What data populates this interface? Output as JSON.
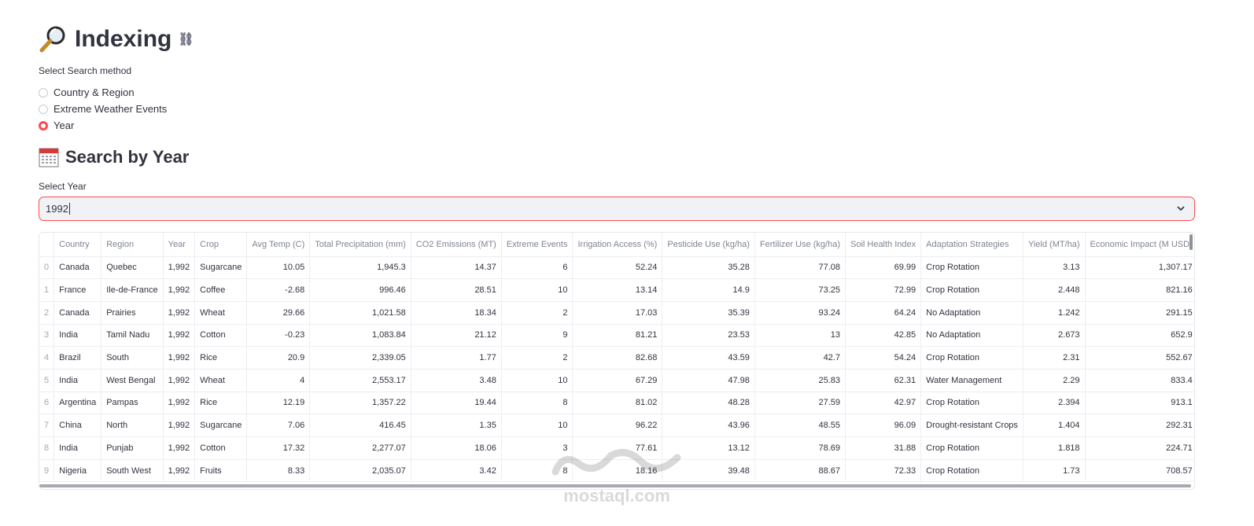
{
  "page": {
    "title": "Indexing"
  },
  "search": {
    "label": "Select Search method",
    "options": [
      "Country & Region",
      "Extreme Weather Events",
      "Year"
    ],
    "selected": "Year"
  },
  "section": {
    "title": "Search by Year",
    "select_label": "Select Year",
    "select_value": "1992"
  },
  "table": {
    "columns": [
      "",
      "Country",
      "Region",
      "Year",
      "Crop",
      "Avg Temp (C)",
      "Total Precipitation (mm)",
      "CO2 Emissions (MT)",
      "Extreme Events",
      "Irrigation Access (%)",
      "Pesticide Use (kg/ha)",
      "Fertilizer Use (kg/ha)",
      "Soil Health Index",
      "Adaptation Strategies",
      "Yield (MT/ha)",
      "Economic Impact (M USD)"
    ],
    "rows": [
      [
        "0",
        "Canada",
        "Quebec",
        "1,992",
        "Sugarcane",
        "10.05",
        "1,945.3",
        "14.37",
        "6",
        "52.24",
        "35.28",
        "77.08",
        "69.99",
        "Crop Rotation",
        "3.13",
        "1,307.17"
      ],
      [
        "1",
        "France",
        "Ile-de-France",
        "1,992",
        "Coffee",
        "-2.68",
        "996.46",
        "28.51",
        "10",
        "13.14",
        "14.9",
        "73.25",
        "72.99",
        "Crop Rotation",
        "2.448",
        "821.16"
      ],
      [
        "2",
        "Canada",
        "Prairies",
        "1,992",
        "Wheat",
        "29.66",
        "1,021.58",
        "18.34",
        "2",
        "17.03",
        "35.39",
        "93.24",
        "64.24",
        "No Adaptation",
        "1.242",
        "291.15"
      ],
      [
        "3",
        "India",
        "Tamil Nadu",
        "1,992",
        "Cotton",
        "-0.23",
        "1,083.84",
        "21.12",
        "9",
        "81.21",
        "23.53",
        "13",
        "42.85",
        "No Adaptation",
        "2.673",
        "652.9"
      ],
      [
        "4",
        "Brazil",
        "South",
        "1,992",
        "Rice",
        "20.9",
        "2,339.05",
        "1.77",
        "2",
        "82.68",
        "43.59",
        "42.7",
        "54.24",
        "Crop Rotation",
        "2.31",
        "552.67"
      ],
      [
        "5",
        "India",
        "West Bengal",
        "1,992",
        "Wheat",
        "4",
        "2,553.17",
        "3.48",
        "10",
        "67.29",
        "47.98",
        "25.83",
        "62.31",
        "Water Management",
        "2.29",
        "833.4"
      ],
      [
        "6",
        "Argentina",
        "Pampas",
        "1,992",
        "Rice",
        "12.19",
        "1,357.22",
        "19.44",
        "8",
        "81.02",
        "48.28",
        "27.59",
        "42.97",
        "Crop Rotation",
        "2.394",
        "913.1"
      ],
      [
        "7",
        "China",
        "North",
        "1,992",
        "Sugarcane",
        "7.06",
        "416.45",
        "1.35",
        "10",
        "96.22",
        "43.96",
        "48.55",
        "96.09",
        "Drought-resistant Crops",
        "1.404",
        "292.31"
      ],
      [
        "8",
        "India",
        "Punjab",
        "1,992",
        "Cotton",
        "17.32",
        "2,277.07",
        "18.06",
        "3",
        "77.61",
        "13.12",
        "78.69",
        "31.88",
        "Crop Rotation",
        "1.818",
        "224.71"
      ],
      [
        "9",
        "Nigeria",
        "South West",
        "1,992",
        "Fruits",
        "8.33",
        "2,035.07",
        "3.42",
        "8",
        "18.16",
        "39.48",
        "88.67",
        "72.33",
        "Crop Rotation",
        "1.73",
        "708.57"
      ]
    ]
  },
  "watermark": {
    "text": "mostaql.com"
  },
  "colors": {
    "accent": "#ff4b4b",
    "text": "#31333f",
    "muted": "#808495"
  }
}
